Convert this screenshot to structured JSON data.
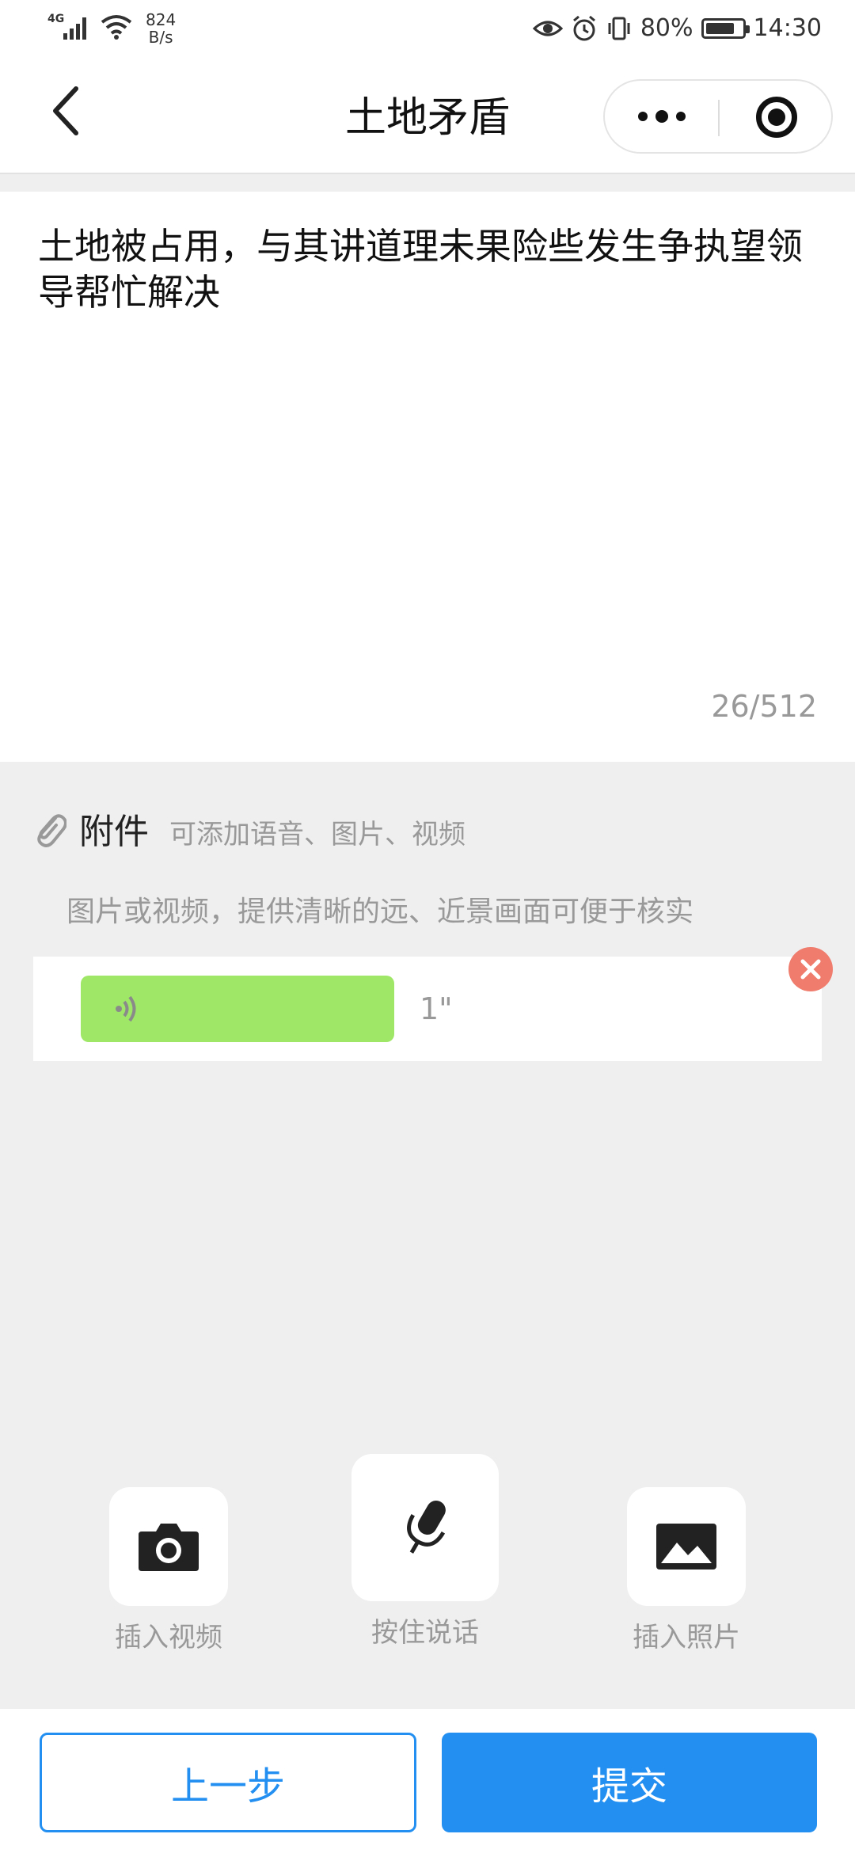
{
  "status_bar": {
    "network": "4G",
    "speed_value": "824",
    "speed_unit": "B/s",
    "battery": "80%",
    "battery_level": 0.8,
    "time": "14:30"
  },
  "nav": {
    "title": "土地矛盾"
  },
  "content": {
    "text": "土地被占用，与其讲道理未果险些发生争执望领导帮忙解决",
    "counter": "26/512"
  },
  "attachment": {
    "title": "附件",
    "hint": "可添加语音、图片、视频",
    "tip": "图片或视频，提供清晰的远、近景画面可便于核实",
    "voice_duration": "1\""
  },
  "tools": {
    "video_label": "插入视频",
    "voice_label": "按住说话",
    "photo_label": "插入照片"
  },
  "footer": {
    "prev_label": "上一步",
    "submit_label": "提交"
  },
  "colors": {
    "primary": "#2390f1",
    "voice_bubble": "#9fe867",
    "remove": "#ef7c6d",
    "background": "#efefef"
  }
}
